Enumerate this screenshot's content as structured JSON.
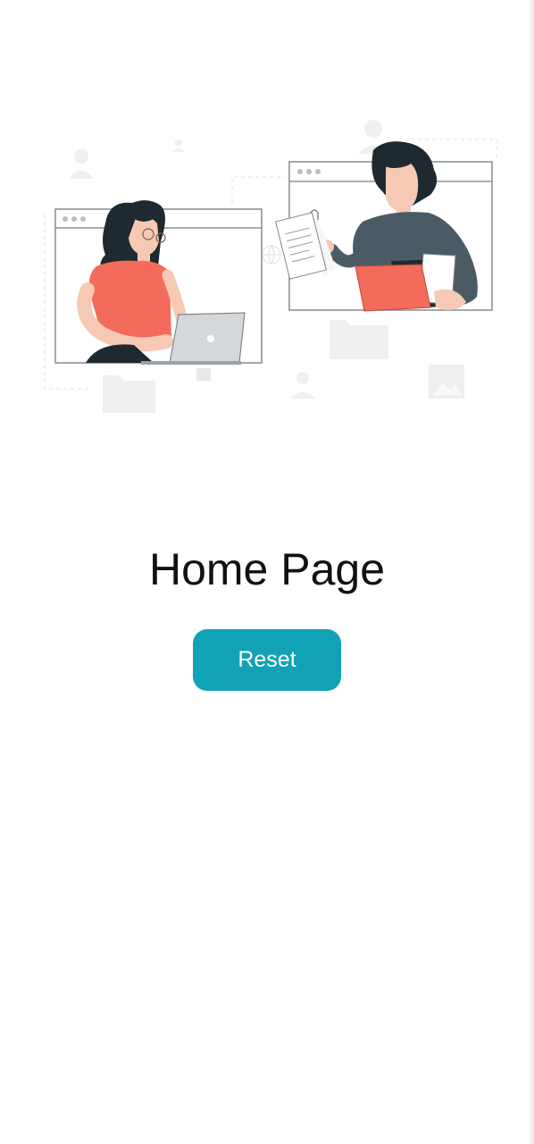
{
  "page": {
    "title": "Home Page"
  },
  "actions": {
    "reset_label": "Reset"
  },
  "colors": {
    "accent": "#12a2b6",
    "shirt_orange": "#f26b5b",
    "sweater_slate": "#4b5b66"
  },
  "illustration": {
    "icon": "remote-collaboration-illustration"
  }
}
